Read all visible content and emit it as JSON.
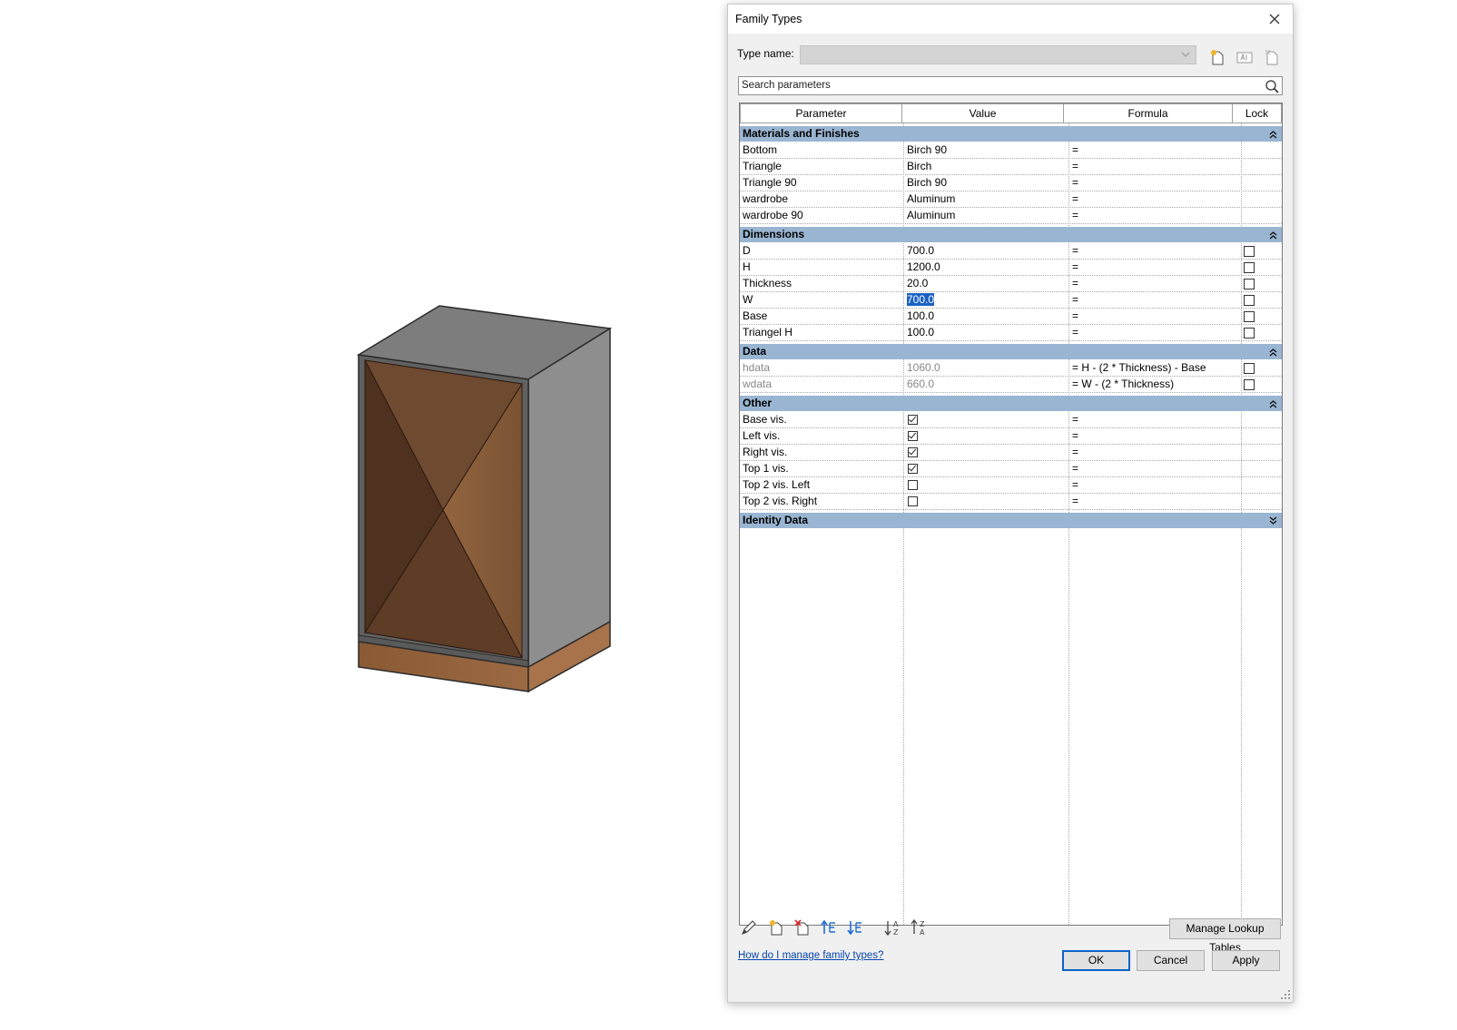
{
  "dialog": {
    "title": "Family Types",
    "type_name_label": "Type name:",
    "search_placeholder": "Search parameters",
    "columns": [
      "Parameter",
      "Value",
      "Formula",
      "Lock"
    ],
    "groups": [
      {
        "name": "Materials and Finishes",
        "expanded": true,
        "rows": [
          {
            "param": "Bottom",
            "value": "Birch 90",
            "formula": "=",
            "lock": null
          },
          {
            "param": "Triangle",
            "value": "Birch",
            "formula": "=",
            "lock": null
          },
          {
            "param": "Triangle 90",
            "value": "Birch 90",
            "formula": "=",
            "lock": null
          },
          {
            "param": "wardrobe",
            "value": "Aluminum",
            "formula": "=",
            "lock": null
          },
          {
            "param": "wardrobe 90",
            "value": "Aluminum",
            "formula": "=",
            "lock": null
          }
        ]
      },
      {
        "name": "Dimensions",
        "expanded": true,
        "rows": [
          {
            "param": "D",
            "value": "700.0",
            "formula": "=",
            "lock": false
          },
          {
            "param": "H",
            "value": "1200.0",
            "formula": "=",
            "lock": false
          },
          {
            "param": "Thickness",
            "value": "20.0",
            "formula": "=",
            "lock": false
          },
          {
            "param": "W",
            "value": "700.0",
            "formula": "=",
            "lock": false,
            "selected": true
          },
          {
            "param": "Base",
            "value": "100.0",
            "formula": "=",
            "lock": false
          },
          {
            "param": "Triangel H",
            "value": "100.0",
            "formula": "=",
            "lock": false
          }
        ]
      },
      {
        "name": "Data",
        "expanded": true,
        "rows": [
          {
            "param": "hdata",
            "value": "1060.0",
            "formula": "= H - (2 * Thickness) - Base",
            "lock": false,
            "readonly": true
          },
          {
            "param": "wdata",
            "value": "660.0",
            "formula": "= W - (2 * Thickness)",
            "lock": false,
            "readonly": true
          }
        ]
      },
      {
        "name": "Other",
        "expanded": true,
        "rows": [
          {
            "param": "Base vis.",
            "check": true,
            "formula": "=",
            "lock": null
          },
          {
            "param": "Left vis.",
            "check": true,
            "formula": "=",
            "lock": null
          },
          {
            "param": "Right vis.",
            "check": true,
            "formula": "=",
            "lock": null
          },
          {
            "param": "Top 1 vis.",
            "check": true,
            "formula": "=",
            "lock": null
          },
          {
            "param": "Top 2 vis. Left",
            "check": false,
            "formula": "=",
            "lock": null
          },
          {
            "param": "Top 2 vis. Right",
            "check": false,
            "formula": "=",
            "lock": null
          }
        ]
      },
      {
        "name": "Identity Data",
        "expanded": false,
        "rows": []
      }
    ],
    "buttons": {
      "manage_lookup": "Manage Lookup Tables",
      "ok": "OK",
      "cancel": "Cancel",
      "apply": "Apply"
    },
    "help_link": "How do I manage family types?"
  },
  "colors": {
    "group_header": "#9ab5d2",
    "selection": "#1a62c4",
    "wood_dark": "#5a3a26",
    "wood_light": "#8a5d3e",
    "cabinet_grey": "#8e8e8e"
  }
}
